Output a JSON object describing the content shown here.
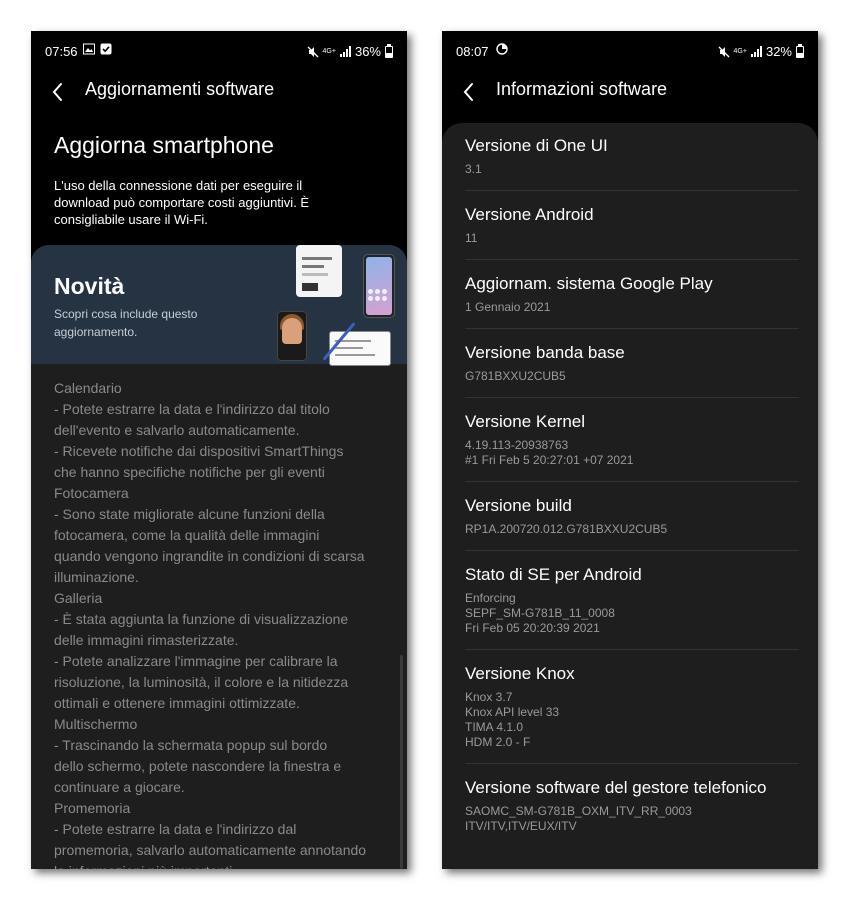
{
  "left": {
    "status": {
      "time": "07:56",
      "battery": "36%",
      "battery_level": 0.36,
      "network": "4G+"
    },
    "app_bar": {
      "title": "Aggiornamenti software"
    },
    "hero": {
      "title": "Aggiorna smartphone",
      "desc_lines": [
        "L'uso della connessione dati per eseguire il",
        "download può comportare costi aggiuntivi. È",
        "consigliabile usare il Wi-Fi."
      ]
    },
    "banner": {
      "title": "Novità",
      "desc_lines": [
        "Scopri cosa include questo",
        "aggiornamento."
      ]
    },
    "notes": [
      "Calendario",
      "- Potete estrarre la data e l'indirizzo dal titolo",
      "dell'evento e salvarlo automaticamente.",
      "- Ricevete notifiche dai dispositivi SmartThings",
      "che hanno specifiche notifiche per gli eventi",
      "Fotocamera",
      "- Sono state migliorate alcune funzioni della",
      "fotocamera, come la qualità delle immagini",
      "quando vengono ingrandite in condizioni di scarsa",
      "illuminazione.",
      "Galleria",
      "- È stata aggiunta la funzione di visualizzazione",
      "delle immagini rimasterizzate.",
      "- Potete analizzare l'immagine per calibrare la",
      "risoluzione, la luminosità, il colore e la nitidezza",
      "ottimali e ottenere immagini ottimizzate.",
      "Multischermo",
      "- Trascinando la schermata popup sul bordo",
      "dello schermo, potete nascondere la finestra e",
      "continuare a giocare.",
      "Promemoria",
      "- Potete estrarre la data e l'indirizzo dal",
      "promemoria, salvarlo automaticamente annotando",
      "le informazioni più importanti."
    ]
  },
  "right": {
    "status": {
      "time": "08:07",
      "battery": "32%",
      "battery_level": 0.32,
      "network": "4G+"
    },
    "app_bar": {
      "title": "Informazioni software"
    },
    "items": [
      {
        "title": "Versione di One UI",
        "values": [
          "3.1"
        ]
      },
      {
        "title": "Versione Android",
        "values": [
          "11"
        ]
      },
      {
        "title": "Aggiornam. sistema Google Play",
        "values": [
          "1 Gennaio 2021"
        ]
      },
      {
        "title": "Versione banda base",
        "values": [
          "G781BXXU2CUB5"
        ]
      },
      {
        "title": "Versione Kernel",
        "values": [
          "4.19.113-20938763",
          "#1 Fri Feb 5 20:27:01 +07 2021"
        ]
      },
      {
        "title": "Versione build",
        "values": [
          "RP1A.200720.012.G781BXXU2CUB5"
        ]
      },
      {
        "title": "Stato di SE per Android",
        "values": [
          "Enforcing",
          "SEPF_SM-G781B_11_0008",
          "Fri Feb 05 20:20:39 2021"
        ]
      },
      {
        "title": "Versione Knox",
        "values": [
          "Knox 3.7",
          "Knox API level 33",
          "TIMA 4.1.0",
          "HDM 2.0 - F"
        ]
      },
      {
        "title": "Versione software del gestore telefonico",
        "values": [
          "SAOMC_SM-G781B_OXM_ITV_RR_0003",
          "ITV/ITV,ITV/EUX/ITV"
        ]
      }
    ]
  },
  "colors": {
    "background": "#000000",
    "card": "#1e1e1e",
    "banner": "#263342",
    "muted_text": "#8a8a8a"
  }
}
